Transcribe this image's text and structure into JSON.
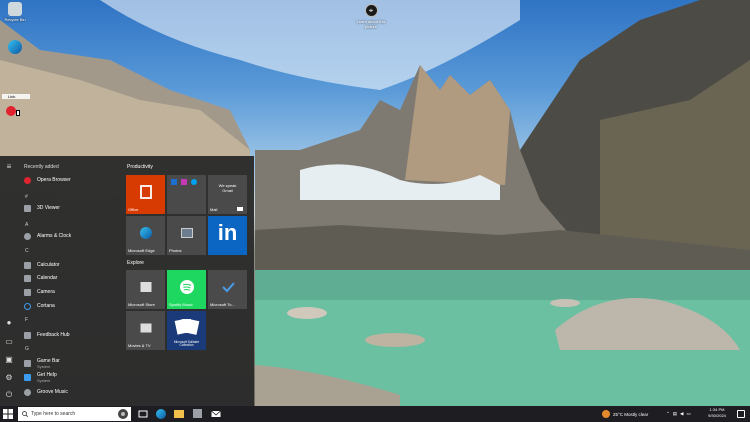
{
  "desktop": {
    "icons": [
      {
        "label": "Recycle Bin"
      },
      {
        "label": ""
      },
      {
        "label": "Link"
      }
    ],
    "learn_label": "Learn about this picture"
  },
  "start_menu": {
    "recently_added_label": "Recently added",
    "apps": [
      {
        "label": "Opera Browser",
        "color": "#e0232f"
      },
      {
        "letter": "#"
      },
      {
        "label": "3D Viewer",
        "color": "#9aa0a6"
      },
      {
        "letter": "A"
      },
      {
        "label": "Alarms & Clock",
        "color": "#9aa0a6"
      },
      {
        "letter": "C"
      },
      {
        "label": "Calculator",
        "color": "#9aa0a6"
      },
      {
        "label": "Calendar",
        "color": "#9aa0a6"
      },
      {
        "label": "Camera",
        "color": "#9aa0a6"
      },
      {
        "label": "Cortana",
        "color": "#3b9cf0"
      },
      {
        "letter": "F"
      },
      {
        "label": "Feedback Hub",
        "color": "#9aa0a6"
      },
      {
        "letter": "G"
      },
      {
        "label": "Game Bar",
        "sub": "System",
        "color": "#9aa0a6"
      },
      {
        "label": "Get Help",
        "sub": "System",
        "color": "#3b9cf0"
      },
      {
        "label": "Groove Music",
        "color": "#9aa0a6"
      }
    ],
    "productivity_label": "Productivity",
    "explore_label": "Explore",
    "tiles": {
      "office": "Office",
      "gmail_text": "We speak Gmail",
      "mail": "Mail",
      "edge": "Microsoft Edge",
      "photos": "Photos",
      "linkedin_text": "in",
      "store": "Microsoft Store",
      "spotify": "Spotify Music",
      "todo": "Microsoft To...",
      "movies": "Movies & TV",
      "solitaire": "Microsoft Solitaire Collection"
    }
  },
  "taskbar": {
    "search_placeholder": "Type here to search",
    "weather": "25°C  Mostly clear",
    "time": "1:34 PM",
    "date": "9/30/2024",
    "colors": {
      "accent": "#0078d7",
      "office": "#d83b01",
      "spotify": "#1ed760",
      "linkedin": "#0a66c2"
    }
  }
}
